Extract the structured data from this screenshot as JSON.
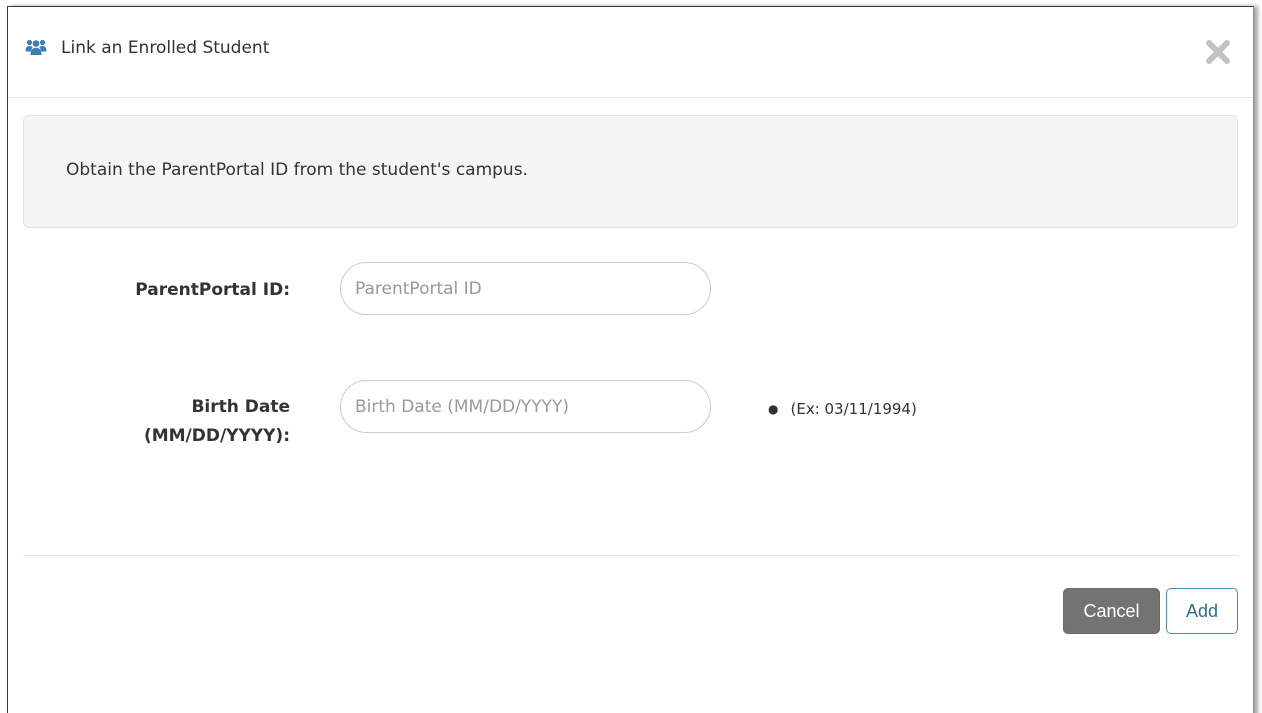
{
  "dialog": {
    "title": "Link an Enrolled Student",
    "icon": "users-icon",
    "close_icon": "close-icon"
  },
  "alert": {
    "message": "Obtain the ParentPortal ID from the student's campus."
  },
  "form": {
    "parent_portal_id": {
      "label": "ParentPortal ID:",
      "placeholder": "ParentPortal ID",
      "value": ""
    },
    "birth_date": {
      "label_line1": "Birth Date",
      "label_line2": "(MM/DD/YYYY):",
      "placeholder": "Birth Date (MM/DD/YYYY)",
      "value": "",
      "hint": "(Ex: 03/11/1994)"
    }
  },
  "buttons": {
    "cancel_label": "Cancel",
    "add_label": "Add"
  },
  "colors": {
    "icon_blue": "#3b7fb6",
    "cancel_bg": "#737373",
    "add_border": "#4a8fb0",
    "add_text": "#2f6e8f"
  }
}
